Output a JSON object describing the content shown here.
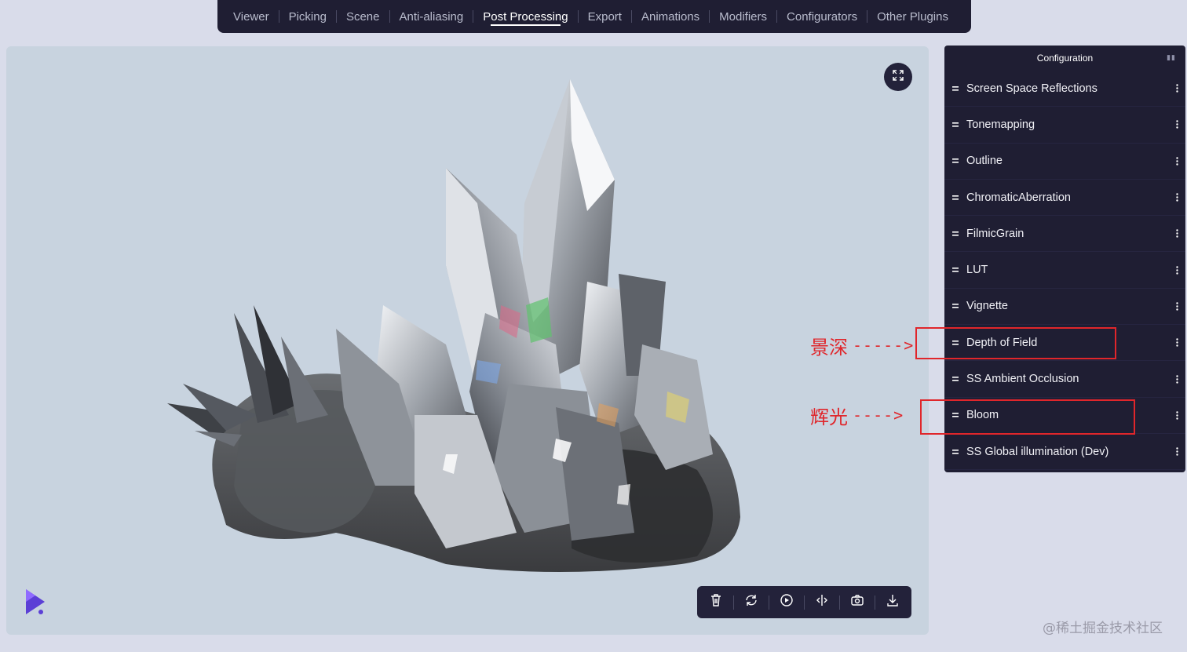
{
  "nav": {
    "tabs": [
      {
        "label": "Viewer"
      },
      {
        "label": "Picking"
      },
      {
        "label": "Scene"
      },
      {
        "label": "Anti-aliasing"
      },
      {
        "label": "Post Processing",
        "active": true
      },
      {
        "label": "Export"
      },
      {
        "label": "Animations"
      },
      {
        "label": "Modifiers"
      },
      {
        "label": "Configurators"
      },
      {
        "label": "Other Plugins"
      }
    ]
  },
  "viewport": {
    "background_color": "#c8d3df",
    "fullscreen_icon": "expand-icon",
    "logo_icon": "app-logo-icon",
    "toolbar": [
      {
        "icon": "trash-icon"
      },
      {
        "icon": "rotate-icon"
      },
      {
        "icon": "play-icon"
      },
      {
        "icon": "split-view-icon"
      },
      {
        "icon": "camera-icon"
      },
      {
        "icon": "download-icon"
      }
    ]
  },
  "panel": {
    "title": "Configuration",
    "items": [
      {
        "label": "Screen Space Reflections"
      },
      {
        "label": "Tonemapping"
      },
      {
        "label": "Outline"
      },
      {
        "label": "ChromaticAberration"
      },
      {
        "label": "FilmicGrain"
      },
      {
        "label": "LUT"
      },
      {
        "label": "Vignette"
      },
      {
        "label": "Depth of Field"
      },
      {
        "label": "SS Ambient Occlusion"
      },
      {
        "label": "Bloom"
      },
      {
        "label": "SS Global illumination (Dev)"
      }
    ]
  },
  "annotations": [
    {
      "text": "景深",
      "arrow": "----->"
    },
    {
      "text": "辉光",
      "arrow": "---->"
    }
  ],
  "watermark": "@稀土掘金技术社区",
  "colors": {
    "dark": "#1f1e33",
    "annotation": "#e0262b",
    "page_bg": "#d9dcea"
  }
}
